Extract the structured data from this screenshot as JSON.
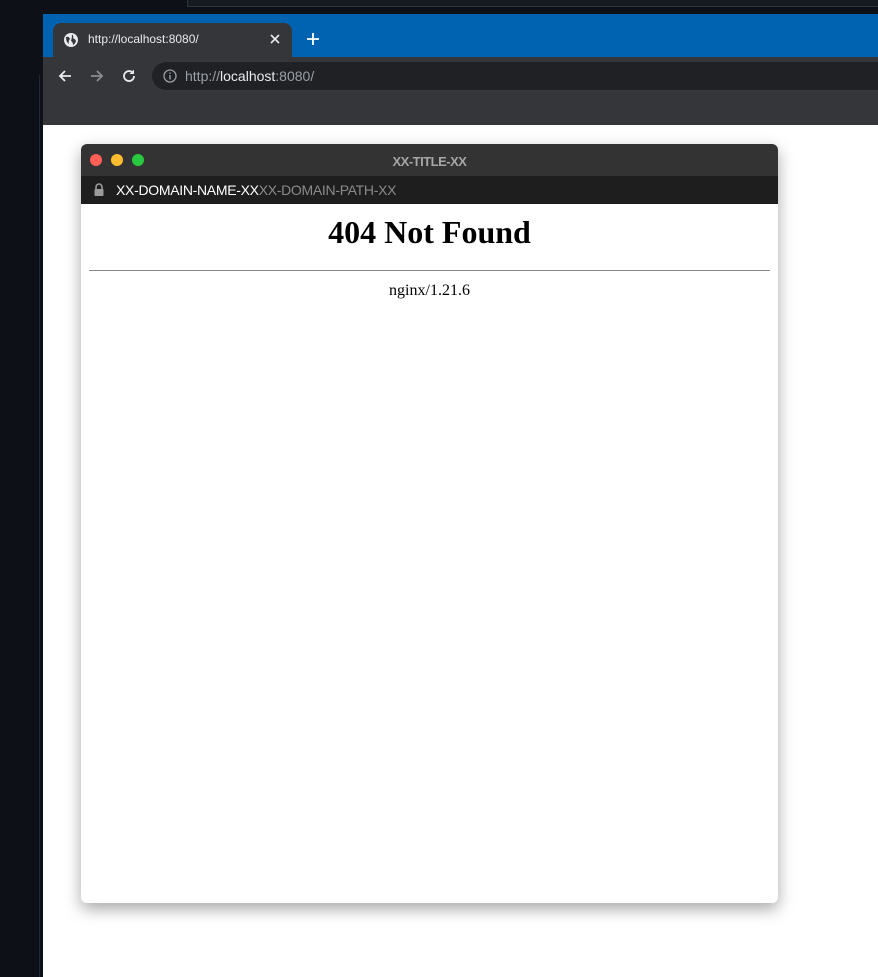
{
  "browser": {
    "tab": {
      "title": "http://localhost:8080/"
    },
    "address": {
      "scheme": "http://",
      "host": "localhost",
      "port_path": ":8080/"
    }
  },
  "frame": {
    "title": "XX-TITLE-XX",
    "domain": "XX-DOMAIN-NAME-XX",
    "path": "XX-DOMAIN-PATH-XX"
  },
  "page": {
    "heading": "404 Not Found",
    "server": "nginx/1.21.6"
  },
  "colors": {
    "tabbar": "#0063b1",
    "toolbar": "#35363a",
    "omnibox": "#202124",
    "frame_titlebar": "#333333",
    "frame_addressbar": "#1e1e1e"
  },
  "icons": [
    "globe-icon",
    "close-icon",
    "plus-icon",
    "back-arrow-icon",
    "forward-arrow-icon",
    "reload-icon",
    "info-icon",
    "lock-icon"
  ]
}
